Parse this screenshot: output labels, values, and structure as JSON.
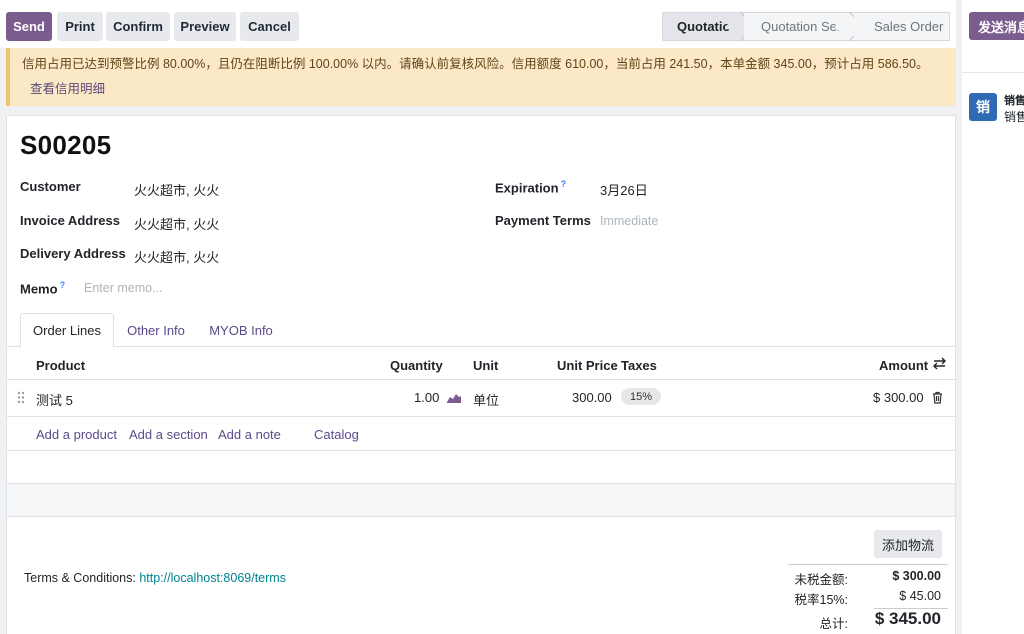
{
  "toolbar": {
    "send": "Send",
    "print": "Print",
    "confirm": "Confirm",
    "preview": "Preview",
    "cancel": "Cancel"
  },
  "statusbar": {
    "stages": [
      "Quotation",
      "Quotation Sent",
      "Sales Order"
    ],
    "active": "Quotation"
  },
  "alert": {
    "message": "信用占用已达到预警比例 80.00%，且仍在阻断比例 100.00% 以内。请确认前复核风险。信用额度 610.00，当前占用 241.50，本单金额 345.00，预计占用 586.50。",
    "link": "查看信用明细"
  },
  "form": {
    "name": "S00205",
    "customer_label": "Customer",
    "customer": "火火超市, 火火",
    "invoice_label": "Invoice Address",
    "invoice": "火火超市, 火火",
    "delivery_label": "Delivery Address",
    "delivery": "火火超市, 火火",
    "memo_label": "Memo",
    "memo_placeholder": "Enter memo...",
    "expiration_label": "Expiration",
    "expiration": "3月26日",
    "payment_label": "Payment Terms",
    "payment_placeholder": "Immediate",
    "help_mark": "?"
  },
  "tabs": [
    "Order Lines",
    "Other Info",
    "MYOB Info"
  ],
  "lines": {
    "headers": {
      "product": "Product",
      "quantity": "Quantity",
      "unit": "Unit",
      "unit_price": "Unit Price",
      "taxes": "Taxes",
      "amount": "Amount"
    },
    "rows": [
      {
        "product": "测试 5",
        "quantity": "1.00",
        "unit": "单位",
        "unit_price": "300.00",
        "tax": "15%",
        "amount": "$ 300.00"
      }
    ],
    "actions": [
      "Add a product",
      "Add a section",
      "Add a note",
      "Catalog"
    ]
  },
  "terms": {
    "label": "Terms & Conditions:",
    "link": "http://localhost:8069/terms"
  },
  "shipping_button": "添加物流",
  "totals": {
    "untaxed_label": "未税金额:",
    "untaxed": "$ 300.00",
    "tax_label": "税率15%:",
    "tax": "$ 45.00",
    "total_label": "总计:",
    "total": "$ 345.00"
  },
  "chatter": {
    "send_message": "发送消息",
    "avatar_text": "销",
    "author": "销售",
    "preview": "销售"
  },
  "colors": {
    "primary": "#7b5c8f",
    "link": "#00848f",
    "alert_bg": "#fbe8c7"
  }
}
